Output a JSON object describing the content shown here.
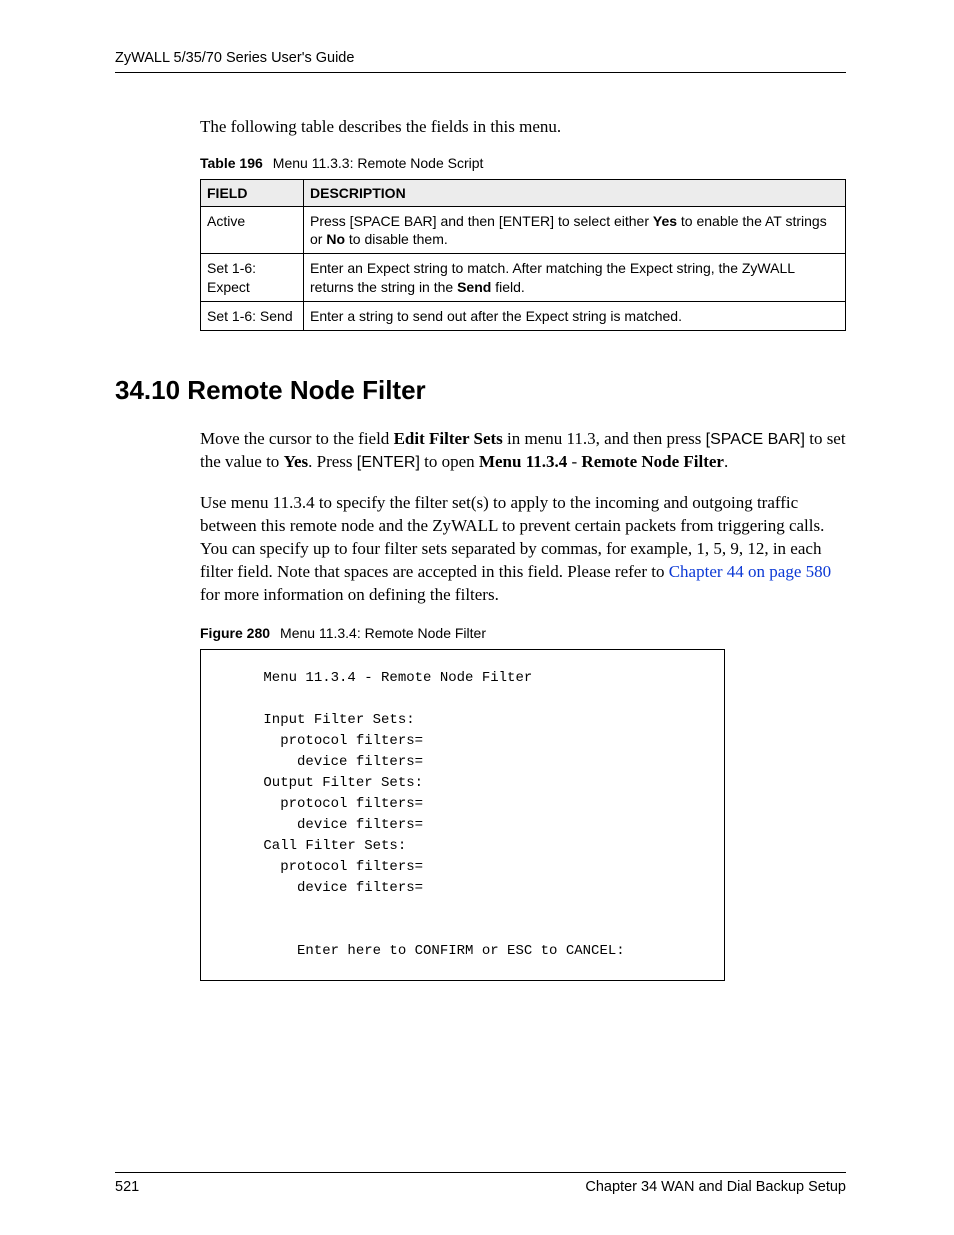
{
  "header": "ZyWALL 5/35/70 Series User's Guide",
  "intro": "The following table describes the fields in this menu.",
  "table": {
    "caption_label": "Table 196",
    "caption_text": "Menu 11.3.3: Remote Node Script",
    "headers": [
      "FIELD",
      "DESCRIPTION"
    ],
    "rows": [
      {
        "field": "Active",
        "desc_pre": "Press [SPACE BAR] and then [ENTER] to select either ",
        "desc_b1": "Yes",
        "desc_mid": " to enable the AT strings or ",
        "desc_b2": "No",
        "desc_post": " to disable them."
      },
      {
        "field": "Set 1-6: Expect",
        "desc_pre": "Enter an Expect string to match. After matching the Expect string, the ZyWALL returns the string in the ",
        "desc_b1": "Send",
        "desc_mid": " field.",
        "desc_b2": "",
        "desc_post": ""
      },
      {
        "field": "Set 1-6: Send",
        "desc_pre": "Enter a string to send out after the Expect string is matched.",
        "desc_b1": "",
        "desc_mid": "",
        "desc_b2": "",
        "desc_post": ""
      }
    ]
  },
  "section_heading": "34.10  Remote Node Filter",
  "p1": {
    "t1": "Move the cursor to the field ",
    "b1": "Edit Filter Sets",
    "t2": " in menu 11.3, and then press ",
    "k1": "[SPACE BAR]",
    "t3": " to set the value to ",
    "b2": "Yes",
    "t4": ". Press ",
    "k2": "[ENTER]",
    "t5": " to open ",
    "b3": "Menu 11.3.4",
    "t6": " - ",
    "b4": "Remote Node Filter",
    "t7": "."
  },
  "p2": {
    "t1": "Use menu 11.3.4 to specify the filter set(s) to apply to the incoming and outgoing traffic between this remote node and the ZyWALL to prevent certain packets from triggering calls. You can specify up to four filter sets separated by commas, for example, 1, 5, 9, 12, in each filter field. Note that spaces are accepted in this field. Please refer to ",
    "link": "Chapter 44 on page 580",
    "t2": " for more information on defining the filters."
  },
  "figure": {
    "caption_label": "Figure 280",
    "caption_text": "Menu 11.3.4: Remote Node Filter",
    "content": "      Menu 11.3.4 - Remote Node Filter\n\n      Input Filter Sets:\n        protocol filters=\n          device filters=\n      Output Filter Sets:\n        protocol filters=\n          device filters=\n      Call Filter Sets:\n        protocol filters=\n          device filters=\n\n\n          Enter here to CONFIRM or ESC to CANCEL:"
  },
  "footer": {
    "page": "521",
    "chapter": "Chapter 34 WAN and Dial Backup Setup"
  }
}
